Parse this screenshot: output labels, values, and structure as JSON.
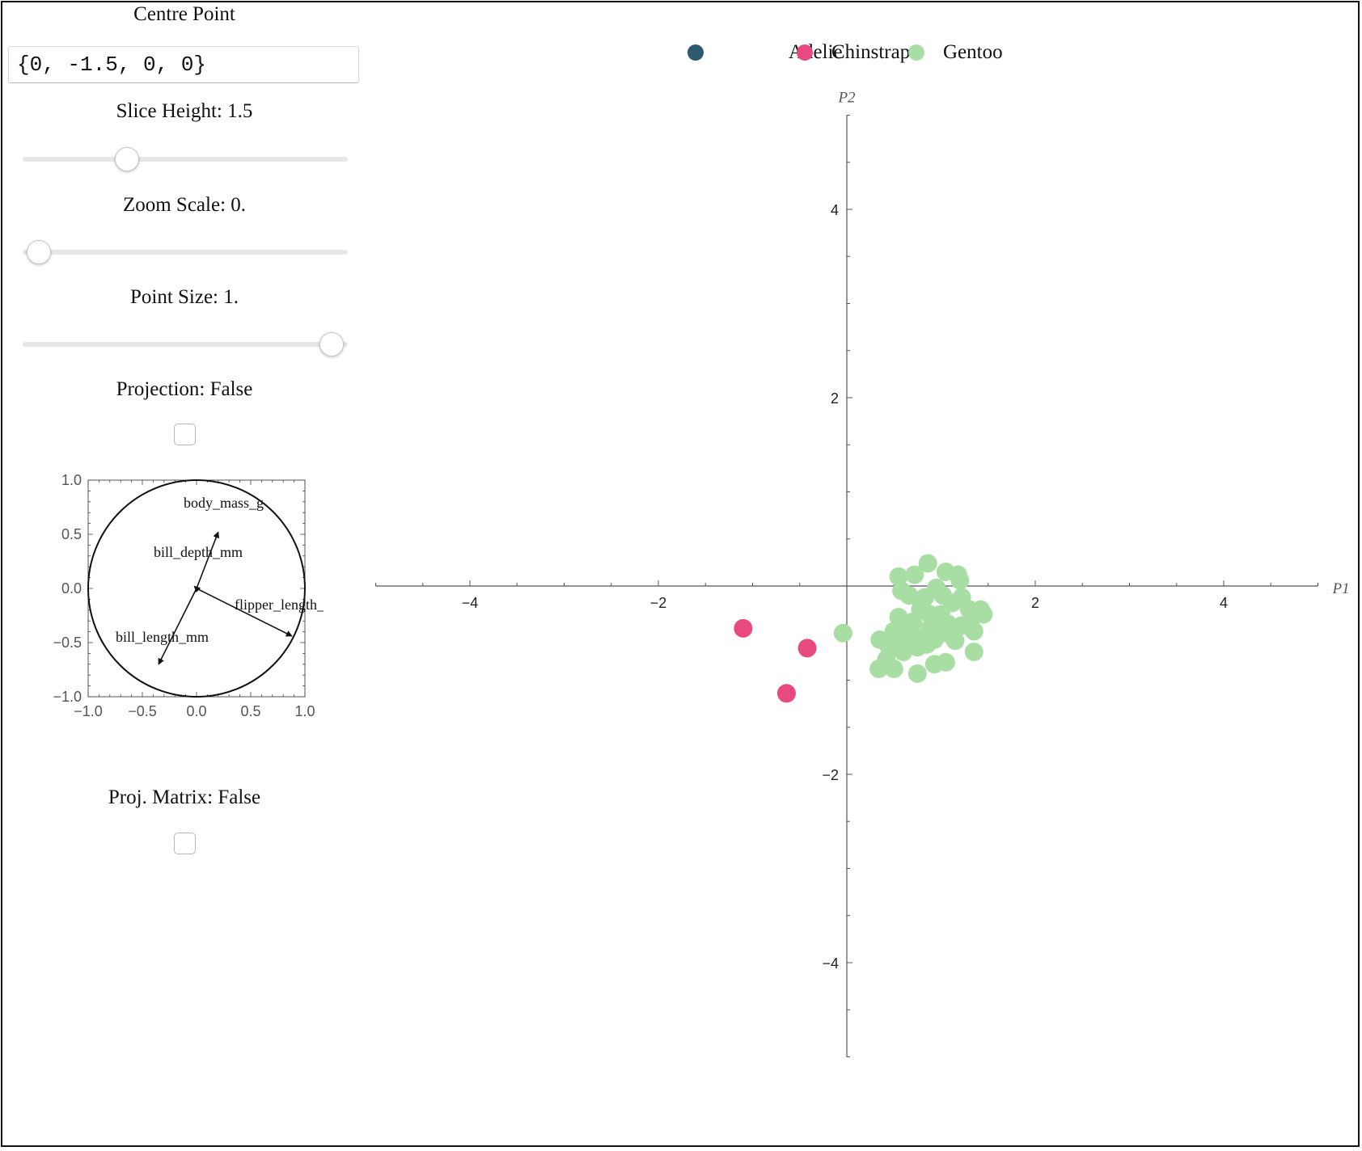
{
  "controls": {
    "centre_point_label": "Centre Point",
    "centre_point_value": "{0, -1.5, 0, 0}",
    "slice_height_label": "Slice Height: 1.5",
    "slice_height_fraction": 0.32,
    "zoom_scale_label": "Zoom Scale: 0.",
    "zoom_scale_fraction": 0.05,
    "point_size_label": "Point Size: 1.",
    "point_size_fraction": 0.95,
    "projection_label": "Projection: False",
    "projection_checked": false,
    "proj_matrix_label": "Proj. Matrix: False",
    "proj_matrix_checked": false
  },
  "chart_data": [
    {
      "type": "scatter",
      "legend": [
        {
          "name": "Adelie",
          "color": "#2c5a6f"
        },
        {
          "name": "Chinstrap",
          "color": "#e8497e"
        },
        {
          "name": "Gentoo",
          "color": "#a8deA4"
        }
      ],
      "legend_placement": "top-center",
      "xlabel": "P1",
      "ylabel": "P2",
      "xlim": [
        -5,
        5
      ],
      "ylim": [
        -5,
        5
      ],
      "xticks": [
        -4,
        -2,
        2,
        4
      ],
      "yticks": [
        -4,
        -2,
        2,
        4
      ],
      "series": [
        {
          "name": "Adelie",
          "color": "#2c5a6f",
          "points": []
        },
        {
          "name": "Chinstrap",
          "color": "#e8497e",
          "points": [
            [
              -1.1,
              -0.45
            ],
            [
              -0.42,
              -0.66
            ],
            [
              -0.64,
              -1.14
            ]
          ]
        },
        {
          "name": "Gentoo",
          "color": "#a8dea4",
          "points": [
            [
              -0.04,
              -0.5
            ],
            [
              0.55,
              0.1
            ],
            [
              0.72,
              0.12
            ],
            [
              0.86,
              0.24
            ],
            [
              1.05,
              0.15
            ],
            [
              1.18,
              0.12
            ],
            [
              1.2,
              0.06
            ],
            [
              0.58,
              -0.05
            ],
            [
              0.66,
              -0.1
            ],
            [
              0.95,
              -0.02
            ],
            [
              1.02,
              -0.1
            ],
            [
              1.12,
              -0.18
            ],
            [
              0.78,
              -0.25
            ],
            [
              0.88,
              -0.3
            ],
            [
              1.22,
              -0.12
            ],
            [
              1.3,
              -0.25
            ],
            [
              1.42,
              -0.25
            ],
            [
              1.45,
              -0.3
            ],
            [
              1.33,
              -0.33
            ],
            [
              0.55,
              -0.33
            ],
            [
              0.7,
              -0.38
            ],
            [
              0.95,
              -0.42
            ],
            [
              1.07,
              -0.4
            ],
            [
              1.22,
              -0.42
            ],
            [
              1.35,
              -0.48
            ],
            [
              0.5,
              -0.48
            ],
            [
              0.62,
              -0.58
            ],
            [
              0.8,
              -0.55
            ],
            [
              0.93,
              -0.57
            ],
            [
              1.05,
              -0.5
            ],
            [
              0.35,
              -0.57
            ],
            [
              0.45,
              -0.65
            ],
            [
              0.6,
              -0.7
            ],
            [
              0.75,
              -0.65
            ],
            [
              0.85,
              -0.62
            ],
            [
              1.15,
              -0.58
            ],
            [
              1.35,
              -0.7
            ],
            [
              0.42,
              -0.78
            ],
            [
              0.93,
              -0.83
            ],
            [
              1.05,
              -0.81
            ],
            [
              0.34,
              -0.88
            ],
            [
              0.5,
              -0.88
            ],
            [
              0.75,
              -0.93
            ],
            [
              0.58,
              -0.48
            ],
            [
              0.68,
              -0.44
            ],
            [
              0.88,
              -0.45
            ],
            [
              1.0,
              -0.3
            ],
            [
              0.83,
              -0.12
            ]
          ]
        }
      ]
    },
    {
      "type": "line",
      "xlim": [
        -1.0,
        1.0
      ],
      "ylim": [
        -1.0,
        1.0
      ],
      "xticks": [
        "-1.0",
        "-0.5",
        "0.0",
        "0.5",
        "1.0"
      ],
      "yticks": [
        "1.0",
        "0.5",
        "0.0",
        "-0.5",
        "-1.0"
      ],
      "unit_circle": true,
      "vectors": [
        {
          "name": "body_mass_g",
          "x": 0.2,
          "y": 0.52
        },
        {
          "name": "bill_depth_mm",
          "x": -0.02,
          "y": 0.02
        },
        {
          "name": "flipper_length_mm",
          "x": 0.88,
          "y": -0.44
        },
        {
          "name": "bill_length_mm",
          "x": -0.35,
          "y": -0.7
        }
      ]
    }
  ]
}
